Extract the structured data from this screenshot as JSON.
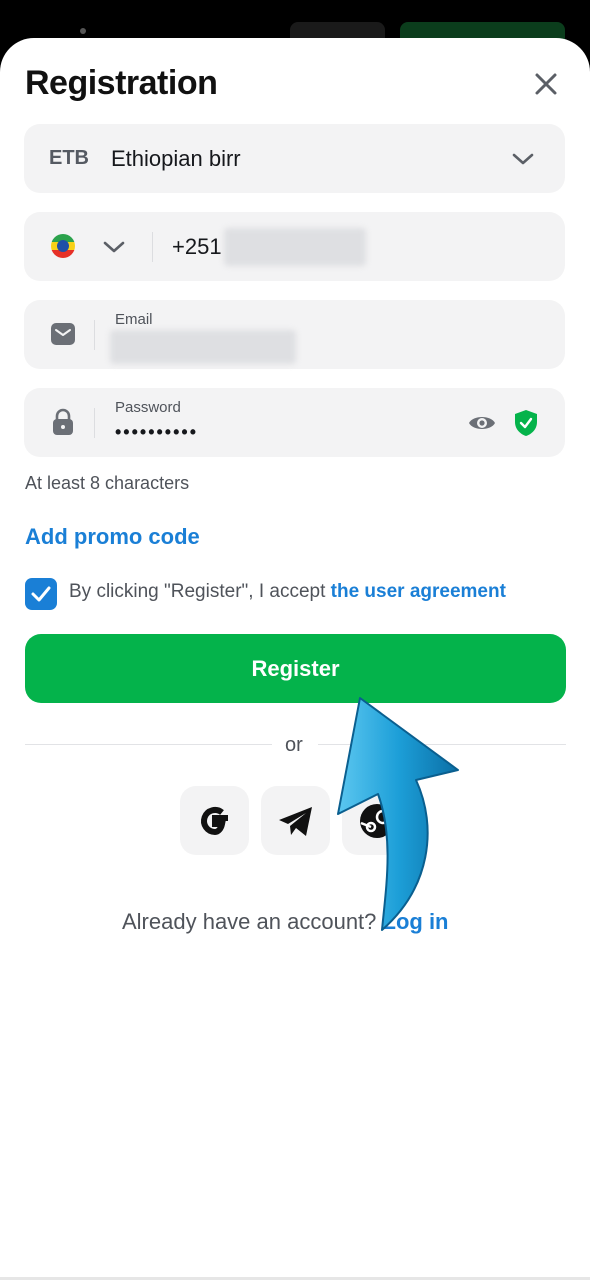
{
  "sheet": {
    "title": "Registration"
  },
  "currency": {
    "code": "ETB",
    "name": "Ethiopian birr"
  },
  "phone": {
    "country_code": "+251"
  },
  "email": {
    "label": "Email"
  },
  "password": {
    "label": "Password",
    "masked_value": "••••••••••",
    "hint": "At least 8 characters"
  },
  "promo": {
    "label": "Add promo code"
  },
  "agreement": {
    "checked": true,
    "text": "By clicking \"Register\", I accept ",
    "link": "the user agreement"
  },
  "register_button": {
    "label": "Register"
  },
  "divider": {
    "label": "or"
  },
  "login_prompt": {
    "text": "Already have an account? ",
    "link": "Log in"
  },
  "colors": {
    "accent": "#1a7fd6",
    "primary_button": "#04b34b",
    "field_bg": "#f3f3f4"
  },
  "icons": [
    "close-icon",
    "chevron-down-icon",
    "ethiopia-flag-icon",
    "mail-icon",
    "lock-icon",
    "eye-icon",
    "shield-check-icon",
    "checkmark-icon",
    "google-icon",
    "telegram-icon",
    "steam-icon",
    "curved-arrow-icon"
  ]
}
